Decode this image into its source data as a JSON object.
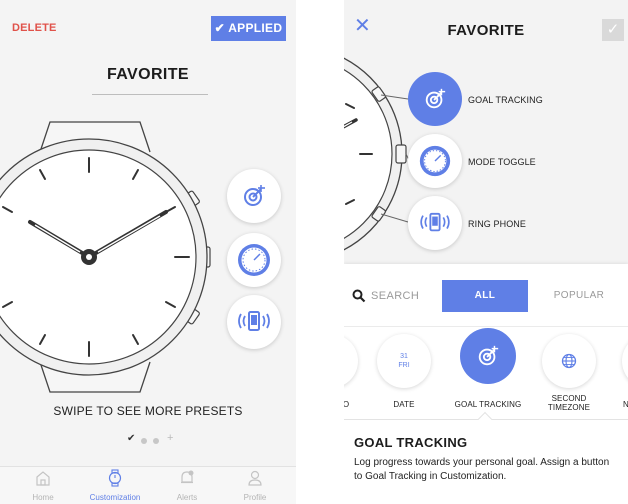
{
  "left": {
    "header": {
      "delete_label": "DELETE",
      "applied_label": "✔ APPLIED"
    },
    "title": "FAVORITE",
    "hands": [
      {
        "icon": "goal-target-icon"
      },
      {
        "icon": "mode-toggle-icon"
      },
      {
        "icon": "ring-phone-icon"
      }
    ],
    "swipe_text": "SWIPE TO SEE MORE PRESETS",
    "pager": {
      "check": "✔",
      "plus": "+"
    },
    "tabbar": [
      {
        "label": "Home",
        "icon": "home-icon"
      },
      {
        "label": "Customization",
        "icon": "watch-icon"
      },
      {
        "label": "Alerts",
        "icon": "bell-icon"
      },
      {
        "label": "Profile",
        "icon": "person-icon"
      }
    ]
  },
  "right": {
    "close_glyph": "✕",
    "title": "FAVORITE",
    "check_glyph": "✓",
    "assigned": [
      {
        "label": "GOAL TRACKING",
        "icon": "goal-target-icon"
      },
      {
        "label": "MODE TOGGLE",
        "icon": "mode-toggle-icon"
      },
      {
        "label": "RING PHONE",
        "icon": "ring-phone-icon"
      }
    ],
    "filters": {
      "search": "SEARCH",
      "all": "ALL",
      "popular": "POPULAR"
    },
    "carousel": [
      {
        "label": "O",
        "icon": "partial-item"
      },
      {
        "label": "DATE",
        "icon": "calendar-date",
        "date_num": "31",
        "date_day": "FRI"
      },
      {
        "label": "GOAL TRACKING",
        "icon": "goal-target-icon"
      },
      {
        "label": "SECOND TIMEZONE",
        "label_line1": "SECOND",
        "label_line2": "TIMEZONE",
        "icon": "globe-icon"
      },
      {
        "label": "N",
        "icon": "partial-item"
      }
    ],
    "detail": {
      "title": "GOAL TRACKING",
      "text": "Log progress towards your personal goal. Assign a button to Goal Tracking in Customization."
    }
  },
  "colors": {
    "accent": "#5f7fe6",
    "delete": "#e0524a",
    "background": "#f4f4f4"
  }
}
